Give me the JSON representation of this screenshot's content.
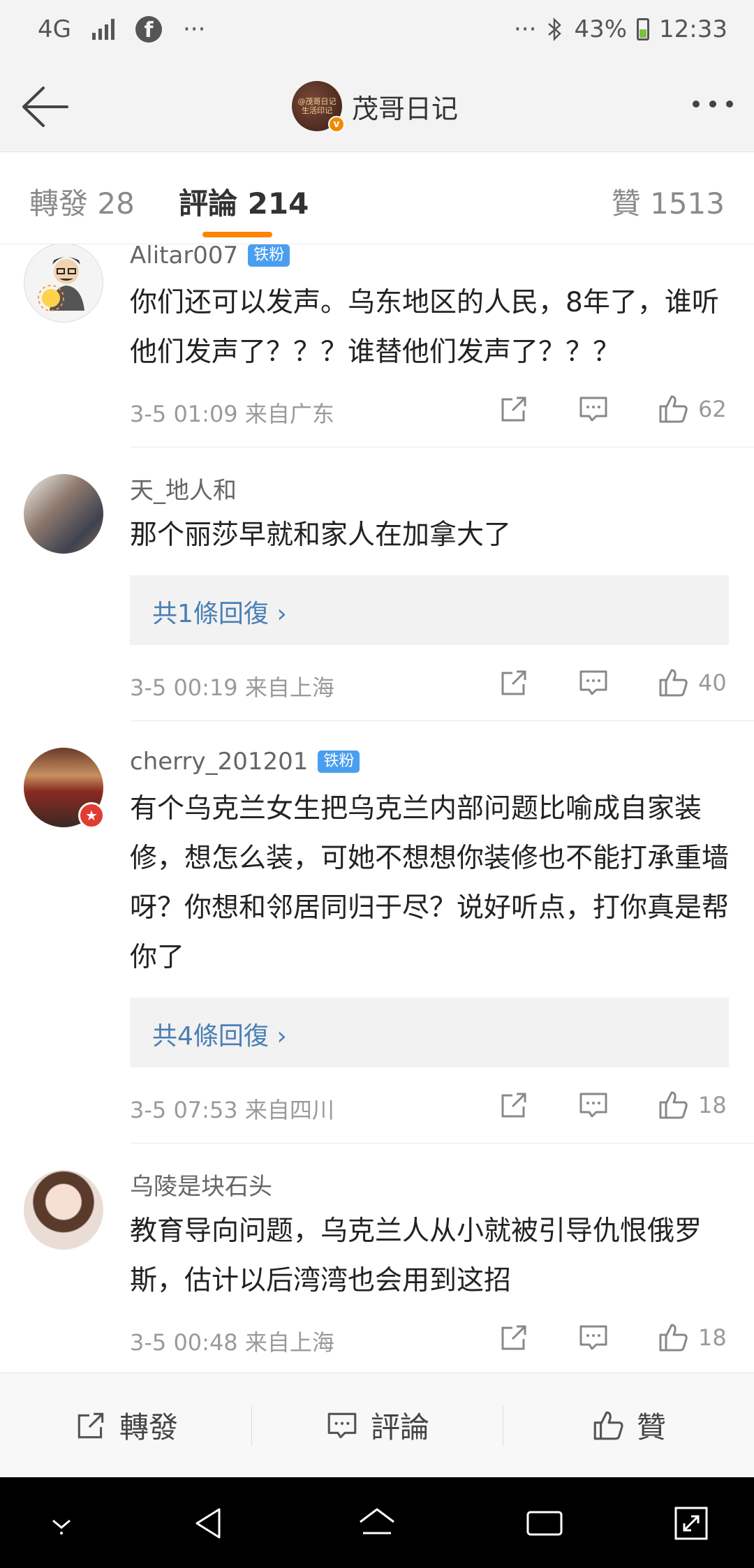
{
  "status_bar": {
    "network": "4G",
    "battery": "43%",
    "time": "12:33",
    "dots": "···",
    "icons": [
      "signal-icon",
      "facebook-icon",
      "bluetooth-icon",
      "battery-icon"
    ]
  },
  "header": {
    "title": "茂哥日记",
    "avatar_text": "@茂哥日记 生活印记"
  },
  "tabs": [
    {
      "label": "轉發 28"
    },
    {
      "label": "評論 214"
    },
    {
      "label": "贊 1513"
    }
  ],
  "comments": [
    {
      "username": "Alitar007",
      "badge": "铁粉",
      "text": "你们还可以发声。乌东地区的人民，8年了，谁听他们发声了？？？谁替他们发声了？？？",
      "time": "3-5 01:09 来自广东",
      "likes": "62",
      "reply": ""
    },
    {
      "username": "天_地人和",
      "badge": "",
      "text": "那个丽莎早就和家人在加拿大了",
      "time": "3-5 00:19 来自上海",
      "likes": "40",
      "reply": "共1條回復 ›"
    },
    {
      "username": "cherry_201201",
      "badge": "铁粉",
      "text": "有个乌克兰女生把乌克兰内部问题比喻成自家装修，想怎么装，可她不想想你装修也不能打承重墙呀？你想和邻居同归于尽？说好听点，打你真是帮你了",
      "time": "3-5 07:53 来自四川",
      "likes": "18",
      "reply": "共4條回復 ›"
    },
    {
      "username": "乌陵是块石头",
      "badge": "",
      "text": "教育导向问题，乌克兰人从小就被引导仇恨俄罗斯，估计以后湾湾也会用到这招",
      "time": "3-5 00:48 来自上海",
      "likes": "18",
      "reply": ""
    }
  ],
  "bottom_bar": {
    "repost": "轉發",
    "comment": "評論",
    "like": "贊"
  },
  "colors": {
    "accent": "#ff8200",
    "link": "#4a7fb5",
    "badge": "#4a9ef0"
  }
}
